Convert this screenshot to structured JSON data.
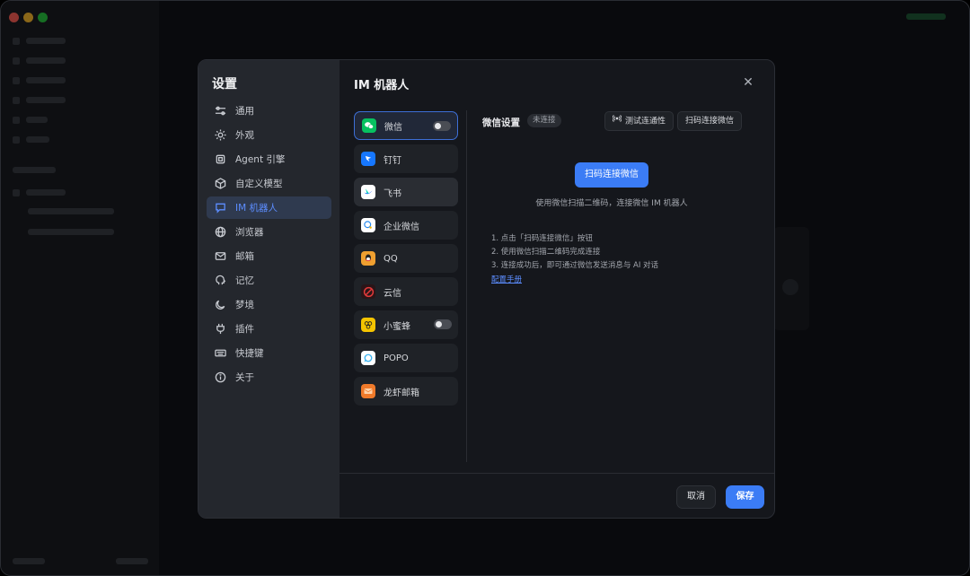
{
  "settings": {
    "title": "设置",
    "nav": [
      {
        "label": "通用",
        "icon": "sliders-icon"
      },
      {
        "label": "外观",
        "icon": "sun-icon"
      },
      {
        "label": "Agent 引擎",
        "icon": "chip-icon"
      },
      {
        "label": "自定义模型",
        "icon": "cube-icon"
      },
      {
        "label": "IM 机器人",
        "icon": "chat-bubble-icon",
        "active": true
      },
      {
        "label": "浏览器",
        "icon": "globe-icon"
      },
      {
        "label": "邮箱",
        "icon": "mail-icon"
      },
      {
        "label": "记忆",
        "icon": "brain-icon"
      },
      {
        "label": "梦境",
        "icon": "moon-icon"
      },
      {
        "label": "插件",
        "icon": "plug-icon"
      },
      {
        "label": "快捷键",
        "icon": "keyboard-icon"
      },
      {
        "label": "关于",
        "icon": "info-icon"
      }
    ]
  },
  "im": {
    "title": "IM 机器人",
    "bots": [
      {
        "label": "微信",
        "icon": "wechat-icon",
        "color": "#07C160",
        "toggle": true,
        "selected": true
      },
      {
        "label": "钉钉",
        "icon": "dingtalk-icon",
        "color": "#1677FF"
      },
      {
        "label": "飞书",
        "icon": "feishu-icon",
        "color": "#ffffff"
      },
      {
        "label": "企业微信",
        "icon": "wecom-icon",
        "color": "#ffffff"
      },
      {
        "label": "QQ",
        "icon": "qq-icon",
        "color": "#F0A030"
      },
      {
        "label": "云信",
        "icon": "yunxin-icon",
        "color": "#E23A3A"
      },
      {
        "label": "小蜜蜂",
        "icon": "bee-icon",
        "color": "#F5C400",
        "toggle": true
      },
      {
        "label": "POPO",
        "icon": "popo-icon",
        "color": "#ffffff"
      },
      {
        "label": "龙虾邮箱",
        "icon": "mailbox-icon",
        "color": "#F07A2A"
      }
    ],
    "detail": {
      "title": "微信设置",
      "status": "未连接",
      "test_btn": "测试连通性",
      "scan_btn": "扫码连接微信",
      "qr_btn": "扫码连接微信",
      "hint": "使用微信扫描二维码，连接微信 IM 机器人",
      "steps": [
        "1. 点击「扫码连接微信」按钮",
        "2. 使用微信扫描二维码完成连接",
        "3. 连接成功后，即可通过微信发送消息与 AI 对话"
      ],
      "manual": "配置手册"
    },
    "cancel": "取消",
    "save": "保存"
  },
  "icons": {
    "close": "close-icon",
    "test": "signal-icon"
  },
  "colors": {
    "accent": "#3b7cf5",
    "active_text": "#5c8dff"
  }
}
